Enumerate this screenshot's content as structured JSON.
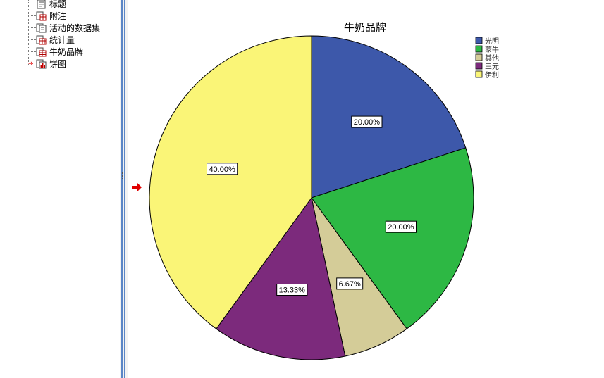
{
  "outline": {
    "items": [
      {
        "label": "标题",
        "icon": "title-doc-icon"
      },
      {
        "label": "附注",
        "icon": "notes-table-icon"
      },
      {
        "label": "活动的数据集",
        "icon": "dataset-doc-icon"
      },
      {
        "label": "统计量",
        "icon": "statistics-table-icon"
      },
      {
        "label": "牛奶品牌",
        "icon": "frequency-table-icon"
      },
      {
        "label": "饼图",
        "icon": "pie-chart-icon",
        "current": true
      }
    ]
  },
  "chart_data": {
    "type": "pie",
    "title": "牛奶品牌",
    "legend_position": "top-right",
    "categories": [
      "光明",
      "蒙牛",
      "其他",
      "三元",
      "伊利"
    ],
    "values": [
      20.0,
      20.0,
      6.67,
      13.33,
      40.0
    ],
    "labels": [
      "20.00%",
      "20.00%",
      "6.67%",
      "13.33%",
      "40.00%"
    ],
    "colors": [
      "#3d58aa",
      "#2db844",
      "#d4cc98",
      "#7c2a7c",
      "#faf577"
    ],
    "start": "12 o'clock",
    "direction": "clockwise"
  }
}
